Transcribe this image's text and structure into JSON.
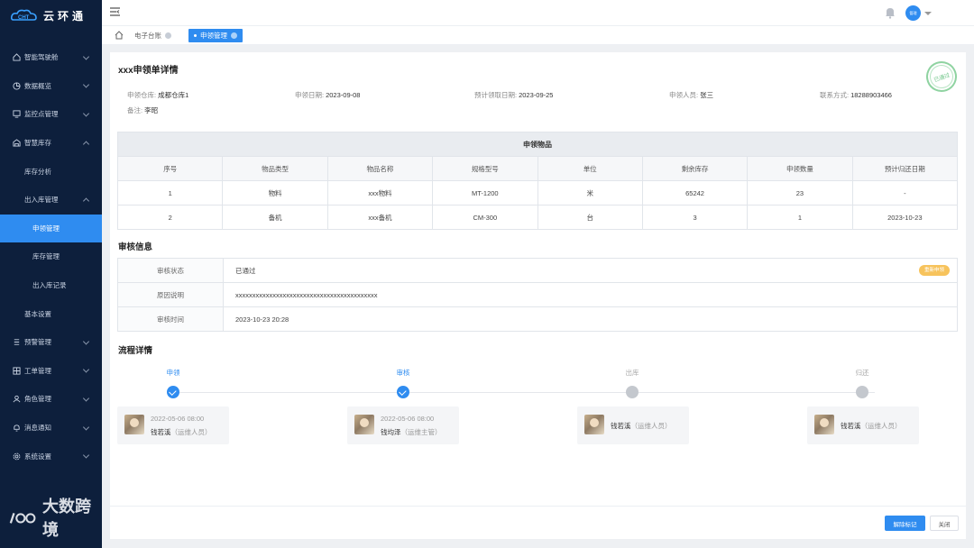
{
  "app": {
    "brand": "云环通",
    "watermark": "大数跨境"
  },
  "sidebar": {
    "items": [
      {
        "label": "智能驾驶舱",
        "icon": "home-icon",
        "expandable": true
      },
      {
        "label": "数据概览",
        "icon": "pie-chart-icon",
        "expandable": true
      },
      {
        "label": "监控点管理",
        "icon": "monitor-icon",
        "expandable": true
      },
      {
        "label": "智慧库存",
        "icon": "warehouse-icon",
        "expandable": true
      },
      {
        "label": "库存分析",
        "level": 1
      },
      {
        "label": "出入库管理",
        "level": 1,
        "expandable": true
      },
      {
        "label": "申领管理",
        "level": 2,
        "active": true
      },
      {
        "label": "库存管理",
        "level": 2
      },
      {
        "label": "出入库记录",
        "level": 2
      },
      {
        "label": "基本设置",
        "level": 1
      },
      {
        "label": "预警管理",
        "icon": "warning-icon",
        "expandable": true
      },
      {
        "label": "工单管理",
        "icon": "ticket-icon",
        "expandable": true
      },
      {
        "label": "角色管理",
        "icon": "user-icon",
        "expandable": true
      },
      {
        "label": "消息通知",
        "icon": "bell-icon",
        "expandable": true
      },
      {
        "label": "系统设置",
        "icon": "gear-icon",
        "expandable": true
      }
    ]
  },
  "topbar": {
    "avatar_text": "管理"
  },
  "tabs": [
    {
      "label": "电子台账"
    },
    {
      "label": "申领管理",
      "active": true
    }
  ],
  "detail": {
    "title": "xxx申领单详情",
    "stamp": "已通过",
    "fields": {
      "warehouse_label": "申领仓库:",
      "warehouse": "成都仓库1",
      "apply_date_label": "申领日期:",
      "apply_date": "2023-09-08",
      "expected_date_label": "预计领取日期:",
      "expected_date": "2023-09-25",
      "applicant_label": "申领人员:",
      "applicant": "张三",
      "contact_label": "联系方式:",
      "contact": "18288903466",
      "remark_label": "备注:",
      "remark": "李昭"
    }
  },
  "items": {
    "caption": "申领物品",
    "headers": [
      "序号",
      "物品类型",
      "物品名称",
      "规格型号",
      "单位",
      "剩余库存",
      "申领数量",
      "预计归还日期"
    ],
    "rows": [
      [
        "1",
        "物料",
        "xxx物料",
        "MT-1200",
        "米",
        "65242",
        "23",
        "-"
      ],
      [
        "2",
        "备机",
        "xxx备机",
        "CM-300",
        "台",
        "3",
        "1",
        "2023-10-23"
      ]
    ]
  },
  "audit": {
    "title": "审核信息",
    "status_label": "审核状态",
    "status": "已通过",
    "reapply_badge": "重新申领",
    "reason_label": "原因说明",
    "reason": "xxxxxxxxxxxxxxxxxxxxxxxxxxxxxxxxxxxxxxxxxx",
    "time_label": "审核时间",
    "time": "2023-10-23 20:28"
  },
  "flow": {
    "title": "流程详情",
    "steps": [
      {
        "label": "申领",
        "done": true,
        "time": "2022-05-06 08:00",
        "person": "钱若溪",
        "role": "（运维人员）"
      },
      {
        "label": "审核",
        "done": true,
        "time": "2022-05-06 08:00",
        "person": "钱均泽",
        "role": "（运维主管）"
      },
      {
        "label": "出库",
        "done": false,
        "person": "钱若溪",
        "role": "（运维人员）"
      },
      {
        "label": "归还",
        "done": false,
        "person": "钱若溪",
        "role": "（运维人员）"
      }
    ]
  },
  "footer": {
    "primary_label": "解除标记",
    "close_label": "关闭"
  },
  "colors": {
    "sidebar_bg": "#0d1f3c",
    "accent": "#2f8cf0",
    "badge": "#f7c35c",
    "stamp": "#6cc486"
  }
}
